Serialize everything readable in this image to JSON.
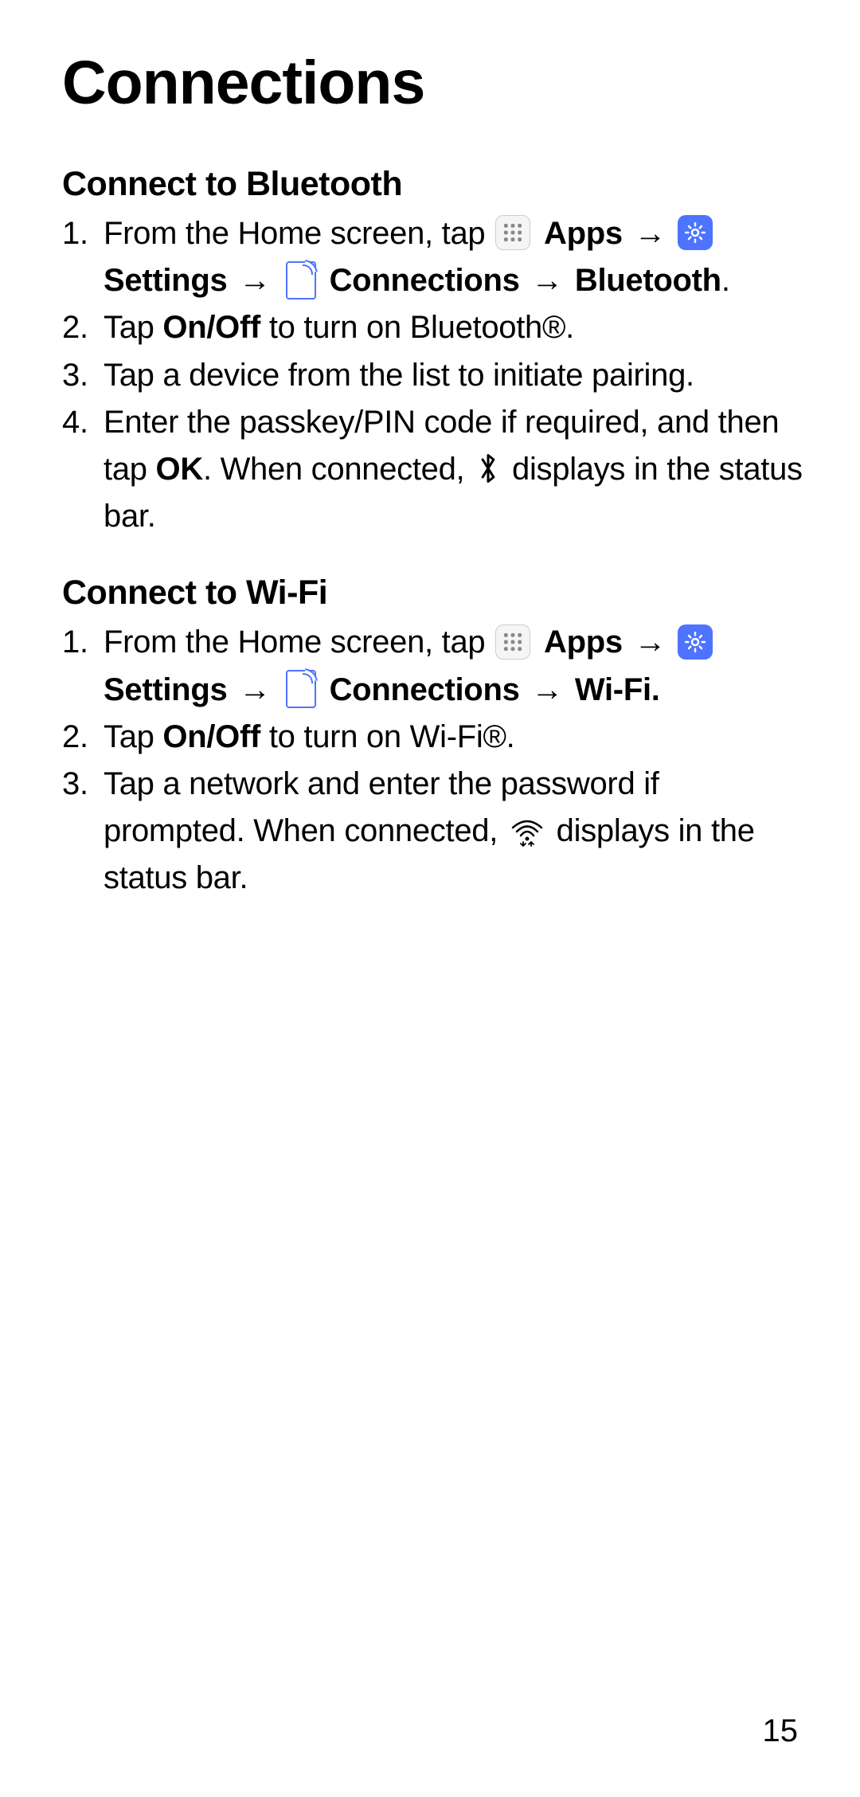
{
  "title": "Connections",
  "sections": [
    {
      "heading": "Connect to Bluetooth",
      "steps": [
        {
          "pre": "From the Home screen, tap ",
          "apps": "Apps",
          "settings": "Settings",
          "connections": "Connections",
          "target": "Bluetooth",
          "targetPunct": "."
        },
        {
          "pre": "Tap ",
          "bold1": "On/Off",
          "post": " to turn on Bluetooth®."
        },
        {
          "text": "Tap a device from the list to initiate pairing."
        },
        {
          "pre": "Enter the passkey/PIN code if required, and then tap ",
          "bold1": "OK",
          "mid": ". When connected, ",
          "iconName": "bluetooth",
          "post": " displays in the status bar."
        }
      ]
    },
    {
      "heading": "Connect to Wi-Fi",
      "steps": [
        {
          "pre": "From the Home screen, tap ",
          "apps": "Apps",
          "settings": "Settings",
          "connections": "Connections",
          "target": "Wi-Fi.",
          "targetPunct": ""
        },
        {
          "pre": "Tap ",
          "bold1": "On/Off",
          "post": " to turn on Wi-Fi®."
        },
        {
          "pre": "Tap a network and enter the password if prompted. When connected, ",
          "iconName": "wifi",
          "post": " displays in the status bar."
        }
      ]
    }
  ],
  "arrow": "→",
  "pageNumber": "15"
}
